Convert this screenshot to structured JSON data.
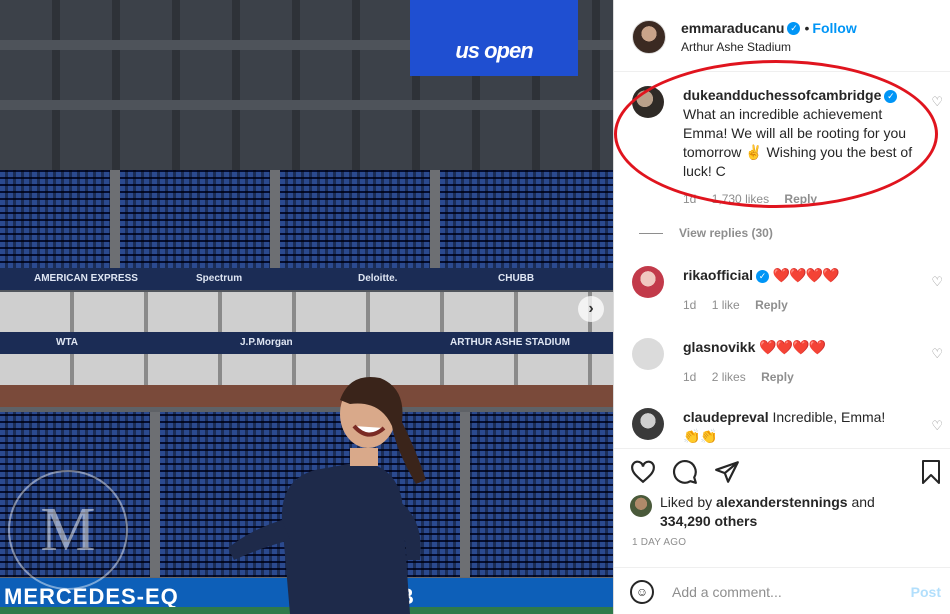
{
  "photo": {
    "scoreboard_text": "us open",
    "sponsors": [
      "AMERICAN EXPRESS",
      "Spectrum",
      "Deloitte.",
      "CHUBB",
      "WTA",
      "J.P.Morgan",
      "ARTHUR ASHE STADIUM"
    ],
    "banner_text": "MERCEDES-EQ",
    "banner_right": "B",
    "watermark": "M",
    "next_icon": "chevron-right-icon"
  },
  "header": {
    "username": "emmaraducanu",
    "follow_label": "Follow",
    "location": "Arthur Ashe Stadium"
  },
  "comments": [
    {
      "username": "dukeandduchessofcambridge",
      "verified": true,
      "text": "What an incredible achievement Emma! We will all be rooting for you tomorrow ✌️ Wishing you the best of luck! C",
      "age": "1d",
      "likes": "1,730 likes",
      "reply": "Reply",
      "view_replies": "View replies (30)"
    },
    {
      "username": "rikaofficial",
      "verified": true,
      "text": "❤️❤️❤️❤️",
      "age": "1d",
      "likes": "1 like",
      "reply": "Reply"
    },
    {
      "username": "glasnovikk",
      "verified": false,
      "text": "❤️❤️❤️❤️",
      "age": "1d",
      "likes": "2 likes",
      "reply": "Reply"
    },
    {
      "username": "claudepreval",
      "verified": false,
      "text": "Incredible, Emma! 👏👏"
    }
  ],
  "actions": {
    "liked_by_prefix": "Liked by",
    "liked_by_user": "alexanderstennings",
    "liked_by_and": "and",
    "others": "334,290 others",
    "time_ago": "1 DAY AGO",
    "comment_placeholder": "Add a comment...",
    "post_label": "Post"
  },
  "icons": [
    "heart-icon",
    "comment-icon",
    "share-icon",
    "bookmark-icon",
    "emoji-icon",
    "verified-icon"
  ],
  "colors": {
    "accent": "#0095f6",
    "annotation": "#e0141e",
    "hearts": "#ed4956"
  }
}
